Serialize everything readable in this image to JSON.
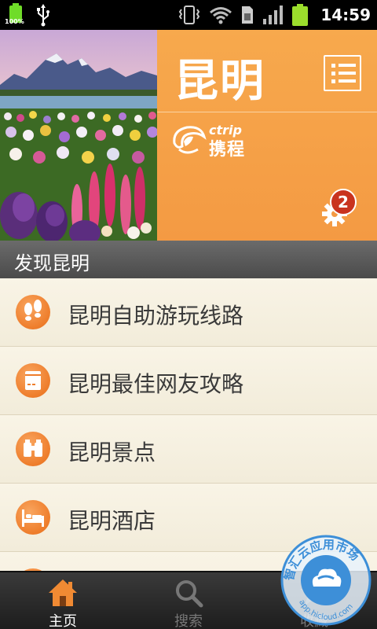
{
  "status_bar": {
    "battery_percent_label": "100%",
    "time": "14:59"
  },
  "header": {
    "city_title": "昆明",
    "brand_latin": "ctrip",
    "brand_cn": "携程",
    "notification_count": "2",
    "accent_color": "#f5a049"
  },
  "section": {
    "title": "发现昆明"
  },
  "list": {
    "items": [
      {
        "label": "昆明自助游玩线路",
        "icon": "footprints-icon"
      },
      {
        "label": "昆明最佳网友攻略",
        "icon": "book-icon"
      },
      {
        "label": "昆明景点",
        "icon": "binoculars-icon"
      },
      {
        "label": "昆明酒店",
        "icon": "bed-icon"
      }
    ]
  },
  "tab_bar": {
    "tabs": [
      {
        "label": "主页",
        "icon": "home-icon",
        "active": true
      },
      {
        "label": "搜索",
        "icon": "search-icon",
        "active": false
      },
      {
        "label": "收藏",
        "icon": "star-icon",
        "active": false
      }
    ]
  },
  "watermark": {
    "text_top": "智汇云应用市场",
    "text_bottom": "app.hicloud.com"
  }
}
